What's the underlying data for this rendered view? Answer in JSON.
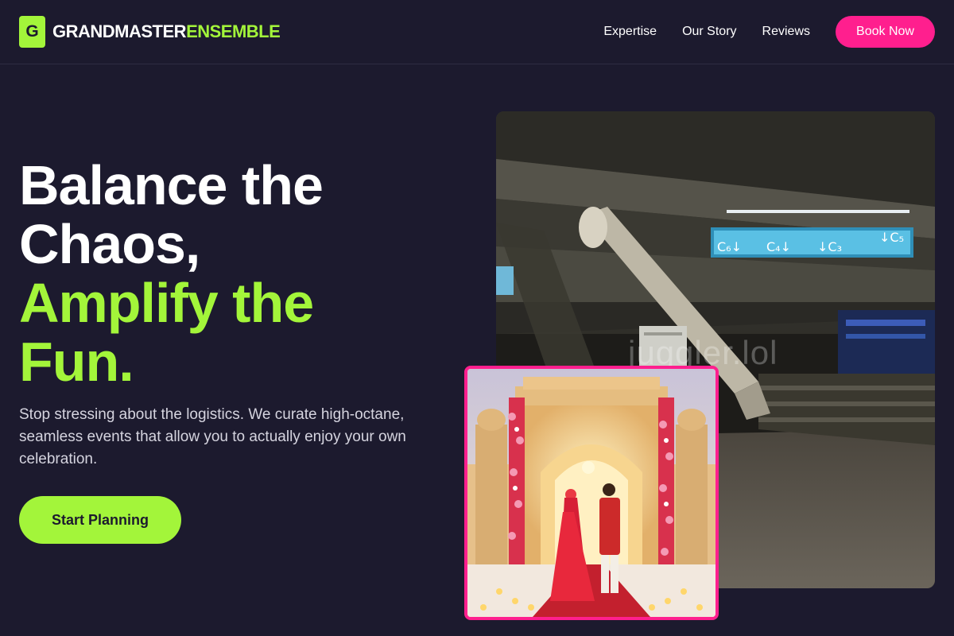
{
  "brand": {
    "logo_letter": "G",
    "name_part1": "GRANDMASTER",
    "name_part2": "ENSEMBLE"
  },
  "nav": {
    "links": [
      "Expertise",
      "Our Story",
      "Reviews"
    ],
    "cta_label": "Book Now"
  },
  "hero": {
    "headline_line1": "Balance the",
    "headline_line2": "Chaos,",
    "headline_line3": "Amplify the",
    "headline_line4": "Fun.",
    "subtext": "Stop stressing about the logistics. We curate high-octane, seamless events that allow you to actually enjoy your own celebration.",
    "cta_label": "Start Planning"
  },
  "images": {
    "venue_signs": [
      "C₆↓",
      "C₄↓",
      "↓C₃",
      "↓C₅"
    ],
    "watermark": "juggler.lol"
  },
  "colors": {
    "background": "#1c1a2e",
    "accent_green": "#a3f53a",
    "accent_pink": "#ff1f8e"
  }
}
